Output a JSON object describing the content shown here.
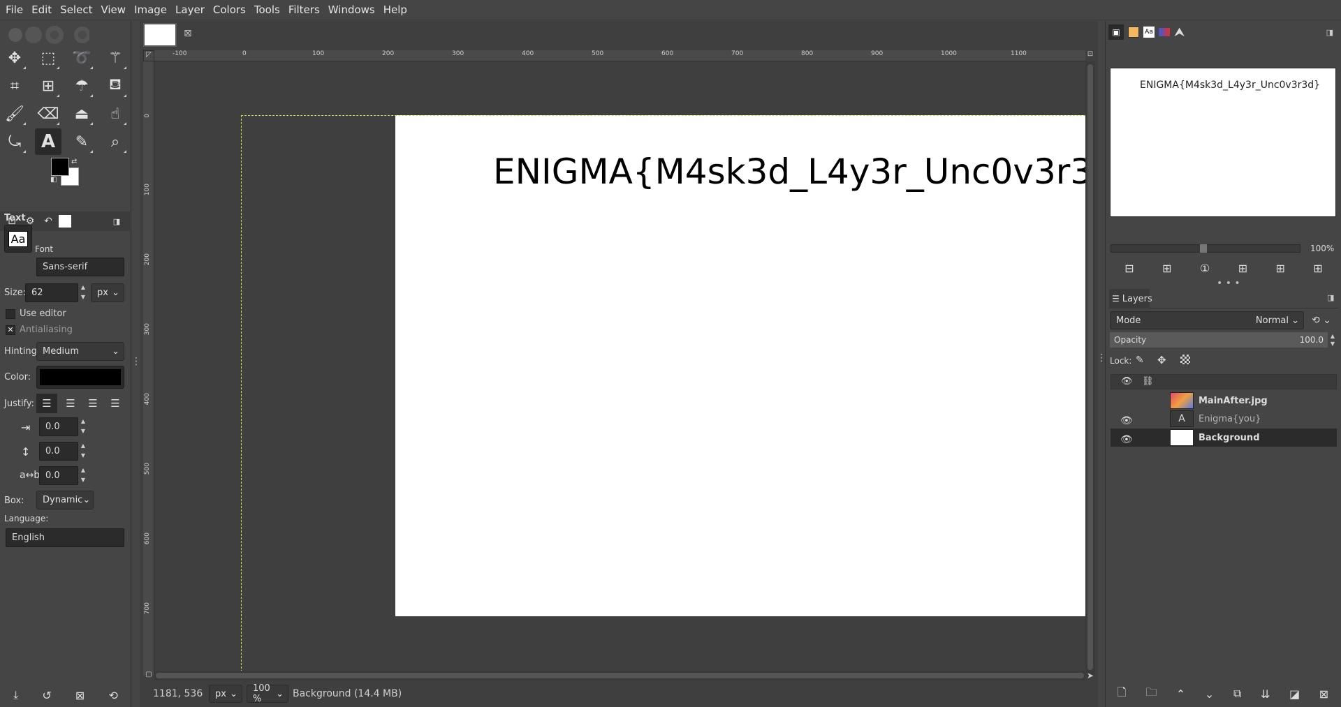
{
  "menubar": {
    "items": [
      "File",
      "Edit",
      "Select",
      "View",
      "Image",
      "Layer",
      "Colors",
      "Tools",
      "Filters",
      "Windows",
      "Help"
    ]
  },
  "tool_options": {
    "title": "Text",
    "font_label": "Font",
    "font_value": "Sans-serif",
    "font_preview": "Aa",
    "size_label": "Size:",
    "size_value": "62",
    "size_unit": "px",
    "use_editor_label": "Use editor",
    "use_editor_checked": false,
    "antialiasing_label": "Antialiasing",
    "antialiasing_checked": true,
    "hinting_label": "Hinting:",
    "hinting_value": "Medium",
    "color_label": "Color:",
    "text_color": "#000000",
    "justify_label": "Justify:",
    "indent_value": "0.0",
    "line_spacing_value": "0.0",
    "letter_spacing_value": "0.0",
    "box_label": "Box:",
    "box_value": "Dynamic",
    "language_label": "Language:",
    "language_value": "English"
  },
  "canvas": {
    "ruler_labels": [
      "-100",
      "0",
      "100",
      "200",
      "300",
      "400",
      "500",
      "600",
      "700",
      "800",
      "900",
      "1000",
      "1100"
    ],
    "ruler_v_labels": [
      "0",
      "100",
      "200",
      "300",
      "400",
      "500",
      "600",
      "700"
    ],
    "text_content": "ENIGMA{M4sk3d_L4y3r_Unc0v3r3d}"
  },
  "statusbar": {
    "coords": "1181, 536",
    "unit": "px",
    "zoom": "100 %",
    "info": "Background (14.4 MB)"
  },
  "navigator": {
    "preview_text": "ENIGMA{M4sk3d_L4y3r_Unc0v3r3d}",
    "zoom": "100%"
  },
  "layers": {
    "tab_label": "Layers",
    "mode_label": "Mode",
    "mode_value": "Normal",
    "opacity_label": "Opacity",
    "opacity_value": "100.0",
    "lock_label": "Lock:",
    "items": [
      {
        "name": "MainAfter.jpg",
        "visible": false,
        "bold": true
      },
      {
        "name": "Enigma{you}",
        "visible": true,
        "bold": false
      },
      {
        "name": "Background",
        "visible": true,
        "bold": true
      }
    ]
  }
}
